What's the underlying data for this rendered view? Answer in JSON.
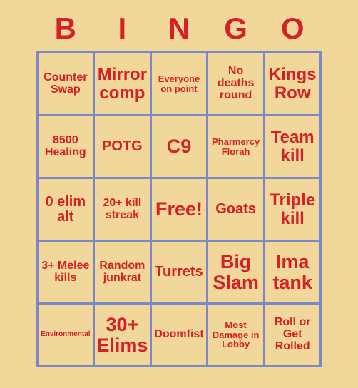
{
  "card": {
    "headers": [
      "B",
      "I",
      "N",
      "G",
      "O"
    ],
    "accent_color": "#d42026",
    "grid_line_color": "#7b87c9",
    "background_color": "#f2d79b",
    "cells": [
      {
        "text": "Counter Swap",
        "size": "fs-sm"
      },
      {
        "text": "Mirror comp",
        "size": "fs-lg"
      },
      {
        "text": "Everyone on point",
        "size": "fs-xs"
      },
      {
        "text": "No deaths round",
        "size": "fs-sm"
      },
      {
        "text": "Kings Row",
        "size": "fs-lg"
      },
      {
        "text": "8500 Healing",
        "size": "fs-sm"
      },
      {
        "text": "POTG",
        "size": "fs-md"
      },
      {
        "text": "C9",
        "size": "fs-xl"
      },
      {
        "text": "Pharmercy Florah",
        "size": "fs-xs"
      },
      {
        "text": "Team kill",
        "size": "fs-lg"
      },
      {
        "text": "0 elim alt",
        "size": "fs-md"
      },
      {
        "text": "20+ kill streak",
        "size": "fs-sm"
      },
      {
        "text": "Free!",
        "size": "fs-xl"
      },
      {
        "text": "Goats",
        "size": "fs-md"
      },
      {
        "text": "Triple kill",
        "size": "fs-lg"
      },
      {
        "text": "3+ Melee kills",
        "size": "fs-sm"
      },
      {
        "text": "Random junkrat",
        "size": "fs-sm"
      },
      {
        "text": "Turrets",
        "size": "fs-md"
      },
      {
        "text": "Big Slam",
        "size": "fs-xl"
      },
      {
        "text": "Ima tank",
        "size": "fs-xl"
      },
      {
        "text": "Environmental",
        "size": "fs-xxs"
      },
      {
        "text": "30+ Elims",
        "size": "fs-xl"
      },
      {
        "text": "Doomfist",
        "size": "fs-sm"
      },
      {
        "text": "Most Damage in Lobby",
        "size": "fs-xs"
      },
      {
        "text": "Roll or Get Rolled",
        "size": "fs-sm"
      }
    ]
  }
}
